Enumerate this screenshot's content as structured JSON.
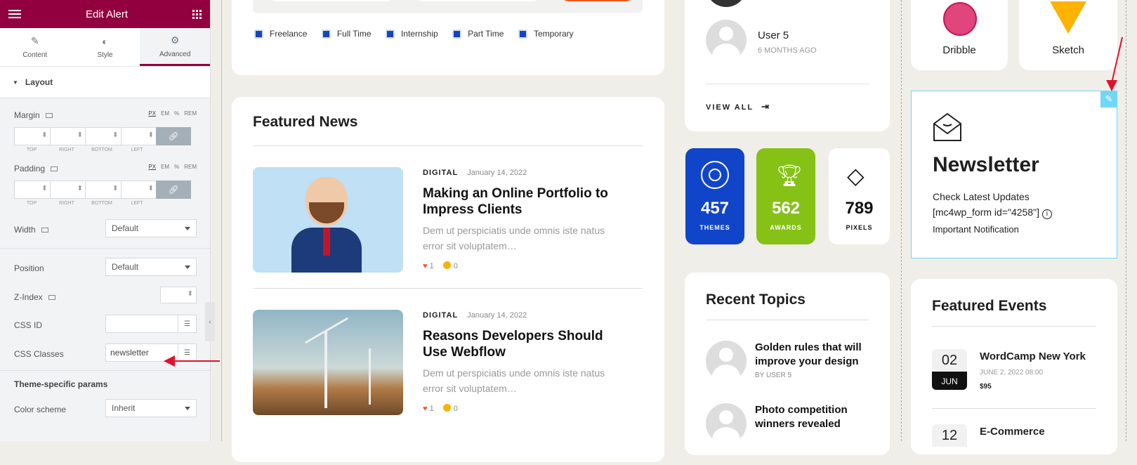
{
  "editor": {
    "title": "Edit Alert",
    "tabs": [
      {
        "label": "Content",
        "icon": "pencil-icon"
      },
      {
        "label": "Style",
        "icon": "half-circle-icon"
      },
      {
        "label": "Advanced",
        "icon": "gear-icon",
        "active": true
      }
    ],
    "section_title": "Layout",
    "units": [
      "PX",
      "EM",
      "%",
      "REM"
    ],
    "margin_label": "Margin",
    "padding_label": "Padding",
    "dim_labels": [
      "TOP",
      "RIGHT",
      "BOTTOM",
      "LEFT"
    ],
    "width_label": "Width",
    "width_value": "Default",
    "position_label": "Position",
    "position_value": "Default",
    "zindex_label": "Z-Index",
    "cssid_label": "CSS ID",
    "cssclasses_label": "CSS Classes",
    "cssclasses_value": "newsletter",
    "theme_params_label": "Theme-specific params",
    "color_scheme_label": "Color scheme",
    "color_scheme_value": "Inherit"
  },
  "job_filters": [
    "Freelance",
    "Full Time",
    "Internship",
    "Part Time",
    "Temporary"
  ],
  "featured_news": {
    "title": "Featured News",
    "items": [
      {
        "category": "DIGITAL",
        "date": "January 14, 2022",
        "title": "Making an Online Portfolio to Impress Clients",
        "excerpt": "Dem ut perspiciatis unde omnis iste natus error sit voluptatem…",
        "likes": "1",
        "comments": "0"
      },
      {
        "category": "DIGITAL",
        "date": "January 14, 2022",
        "title": "Reasons Developers Should Use Webflow",
        "excerpt": "Dem ut perspiciatis unde omnis iste natus error sit voluptatem…",
        "likes": "1",
        "comments": "0"
      }
    ]
  },
  "users": {
    "user_name": "User 5",
    "user_time": "6 MONTHS AGO",
    "view_all": "VIEW ALL"
  },
  "stats": [
    {
      "number": "457",
      "label": "THEMES",
      "color": "#1145c9"
    },
    {
      "number": "562",
      "label": "AWARDS",
      "color": "#86c116"
    },
    {
      "number": "789",
      "label": "PIXELS",
      "color": "#ffffff"
    }
  ],
  "recent_topics": {
    "title": "Recent Topics",
    "items": [
      {
        "title": "Golden rules that will improve your design",
        "by": "BY USER 5"
      },
      {
        "title": "Photo competition winners revealed",
        "by": ""
      }
    ]
  },
  "apps": [
    {
      "name": "Dribble",
      "color": "#e0457b"
    },
    {
      "name": "Sketch",
      "color": "#fdb300"
    }
  ],
  "newsletter": {
    "title": "Newsletter",
    "line1": "Check Latest Updates",
    "line2": "[mc4wp_form id=\"4258\"]",
    "line3": "Important Notification"
  },
  "featured_events": {
    "title": "Featured Events",
    "items": [
      {
        "day": "02",
        "month": "JUN",
        "title": "WordCamp New York",
        "datetime": "JUNE 2, 2022 08:00",
        "price": "$95"
      },
      {
        "day": "12",
        "month": "",
        "title": "E-Commerce",
        "datetime": "",
        "price": ""
      }
    ]
  },
  "colors": {
    "brand": "#93003f",
    "accent": "#ee5a24",
    "annotation": "#e0112b"
  }
}
